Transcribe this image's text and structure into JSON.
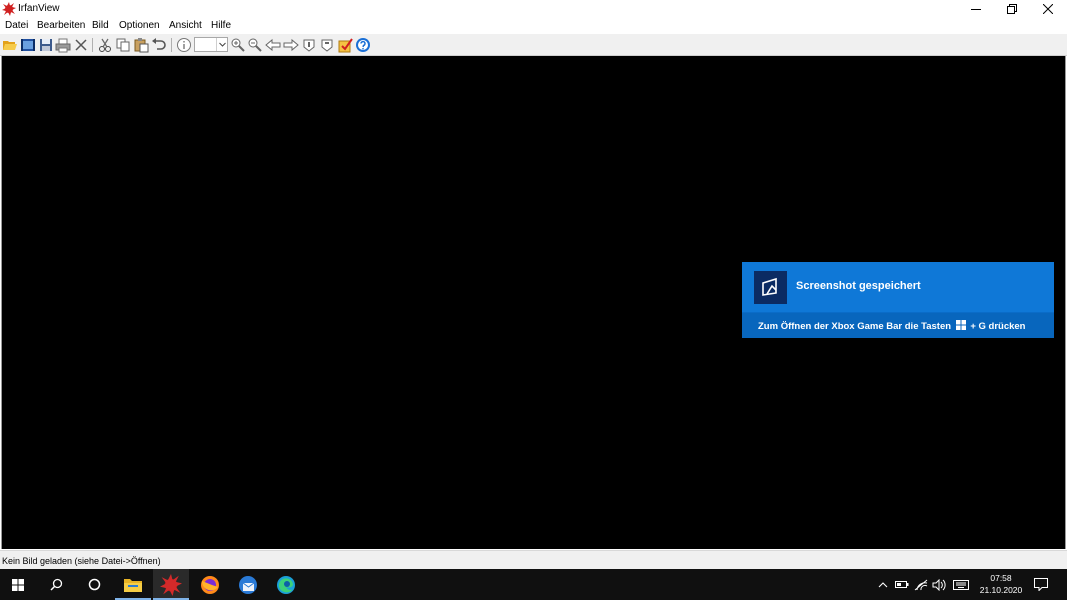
{
  "window": {
    "title": "IrfanView"
  },
  "menu": [
    "Datei",
    "Bearbeiten",
    "Bild",
    "Optionen",
    "Ansicht",
    "Hilfe"
  ],
  "toolbar": {
    "tools": [
      "open-icon",
      "slideshow-icon",
      "save-icon",
      "print-icon",
      "delete-icon",
      "cut-icon",
      "copy-icon",
      "paste-icon",
      "undo-icon",
      "info-icon",
      "zoom-in-icon",
      "zoom-out-icon",
      "previous-icon",
      "next-icon",
      "first-icon",
      "last-icon",
      "edit-icon",
      "help-icon"
    ],
    "zoom_value": ""
  },
  "toast": {
    "title": "Screenshot gespeichert",
    "message_before": "Zum Öffnen der Xbox Game Bar die Tasten",
    "message_after": "+ G drücken"
  },
  "status": {
    "text": "Kein Bild geladen (siehe Datei->Öffnen)"
  },
  "taskbar": {
    "apps": [
      "start-icon",
      "search-icon",
      "cortana-icon",
      "file-explorer-icon",
      "irfanview-icon",
      "firefox-icon",
      "thunderbird-icon",
      "edge-icon"
    ],
    "time": "07:58",
    "date": "21.10.2020"
  },
  "colors": {
    "viewer_bg": "#000000",
    "toast_bg": "#0f78d7",
    "taskbar_bg": "#101010"
  }
}
